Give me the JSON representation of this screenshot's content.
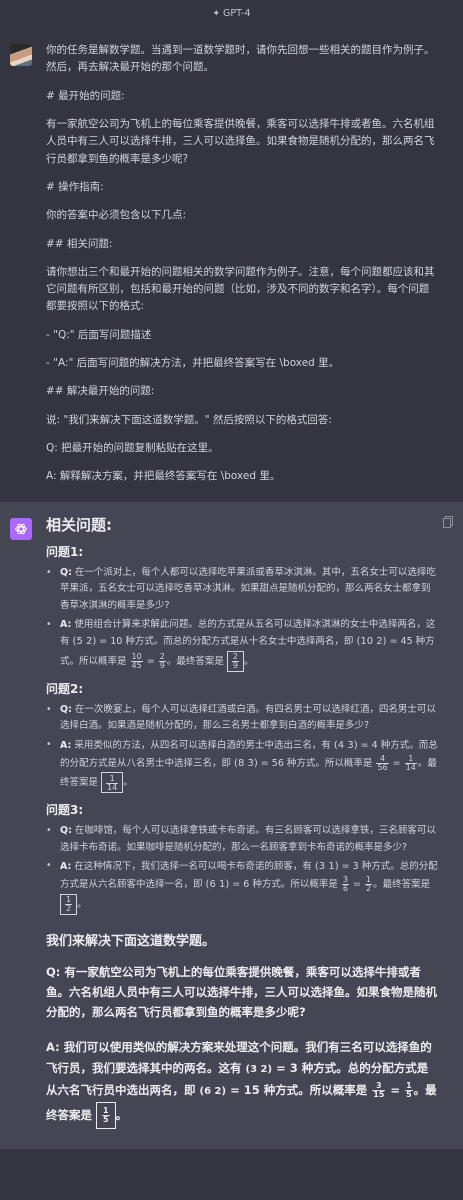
{
  "header": {
    "model_label": "GPT-4"
  },
  "user_message": [
    "你的任务是解数学题。当遇到一道数学题时，请你先回想一些相关的题目作为例子。然后，再去解决最开始的那个问题。",
    "# 最开始的问题:",
    "有一家航空公司为飞机上的每位乘客提供晚餐，乘客可以选择牛排或者鱼。六名机组人员中有三人可以选择牛排，三人可以选择鱼。如果食物是随机分配的，那么两名飞行员都拿到鱼的概率是多少呢?",
    "# 操作指南:",
    "你的答案中必须包含以下几点:",
    "## 相关问题:",
    "请你想出三个和最开始的问题相关的数学问题作为例子。注意，每个问题都应该和其它问题有所区别，包括和最开始的问题（比如，涉及不同的数字和名字）。每个问题都要按照以下的格式:",
    "- \"Q:\" 后面写问题描述",
    "- \"A:\" 后面写问题的解决方法，并把最终答案写在 \\boxed 里。",
    "## 解决最开始的问题:",
    "说: \"我们来解决下面这道数学题。\" 然后按照以下的格式回答:",
    "Q: 把最开始的问题复制粘贴在这里。",
    "A: 解释解决方案，并把最终答案写在 \\boxed 里。"
  ],
  "answer": {
    "heading": "相关问题:",
    "q_label": "Q:",
    "a_label": "A:",
    "problems": [
      {
        "title": "问题1:",
        "q": "在一个派对上，每个人都可以选择吃苹果派或香草冰淇淋。其中，五名女士可以选择吃苹果派，五名女士可以选择吃香草冰淇淋。如果甜点是随机分配的，那么两名女士都拿到香草冰淇淋的概率是多少?",
        "a1": "使用组合计算来求解此问题。总的方式是从五名可以选择冰淇淋的女士中选择两名，这有",
        "binom1": "(5 2)",
        "eq1": "= 10",
        "a2": "种方式。而总的分配方式是从十名女士中选择两名，即",
        "binom2": "(10 2)",
        "eq2": "= 45",
        "a3": "种方式。所以概率是",
        "frac1_n": "10",
        "frac1_d": "45",
        "eq3": "=",
        "frac2_n": "2",
        "frac2_d": "9",
        "a4": "。最终答案是",
        "boxed_n": "2",
        "boxed_d": "9",
        "a5": "。"
      },
      {
        "title": "问题2:",
        "q": "在一次晚宴上，每个人可以选择红酒或白酒。有四名男士可以选择红酒，四名男士可以选择白酒。如果酒是随机分配的，那么三名男士都拿到白酒的概率是多少?",
        "a1": "采用类似的方法，从四名可以选择白酒的男士中选出三名，有",
        "binom1": "(4 3)",
        "eq1": "= 4",
        "a2": "种方式。而总的分配方式是从八名男士中选择三名，即",
        "binom2": "(8 3)",
        "eq2": "= 56",
        "a3": "种方式。所以概率是",
        "frac1_n": "4",
        "frac1_d": "56",
        "eq3": "=",
        "frac2_n": "1",
        "frac2_d": "14",
        "a4": "。最终答案是",
        "boxed_n": "1",
        "boxed_d": "14",
        "a5": "。"
      },
      {
        "title": "问题3:",
        "q": "在咖啡馆，每个人可以选择拿铁或卡布奇诺。有三名顾客可以选择拿铁，三名顾客可以选择卡布奇诺。如果咖啡是随机分配的，那么一名顾客拿到卡布奇诺的概率是多少?",
        "a1": "在这种情况下，我们选择一名可以喝卡布奇诺的顾客，有",
        "binom1": "(3 1)",
        "eq1": "= 3",
        "a2": "种方式。总的分配方式是从六名顾客中选择一名，即",
        "binom2": "(6 1)",
        "eq2": "= 6",
        "a3": "种方式。所以概率是",
        "frac1_n": "3",
        "frac1_d": "6",
        "eq3": "=",
        "frac2_n": "1",
        "frac2_d": "2",
        "a4": "。最终答案是",
        "boxed_n": "1",
        "boxed_d": "2",
        "a5": "。"
      }
    ],
    "solve_heading": "我们来解决下面这道数学题。",
    "solve_q": "Q: 有一家航空公司为飞机上的每位乘客提供晚餐，乘客可以选择牛排或者鱼。六名机组人员中有三人可以选择牛排，三人可以选择鱼。如果食物是随机分配的，那么两名飞行员都拿到鱼的概率是多少呢?",
    "solve_a1": "A: 我们可以使用类似的解决方案来处理这个问题。我们有三名可以选择鱼的飞行员，我们要选择其中的两名。这有",
    "solve_binom1": "(3 2)",
    "solve_eq1": "= 3",
    "solve_a2": "种方式。总的分配方式是从六名飞行员中选出两名，即",
    "solve_binom2": "(6 2)",
    "solve_eq2": "= 15",
    "solve_a3": "种方式。所以概率是",
    "solve_frac1_n": "3",
    "solve_frac1_d": "15",
    "solve_eq3": "=",
    "solve_frac2_n": "1",
    "solve_frac2_d": "5",
    "solve_a4": "。最终答案是",
    "solve_boxed_n": "1",
    "solve_boxed_d": "5",
    "solve_a5": "。"
  }
}
